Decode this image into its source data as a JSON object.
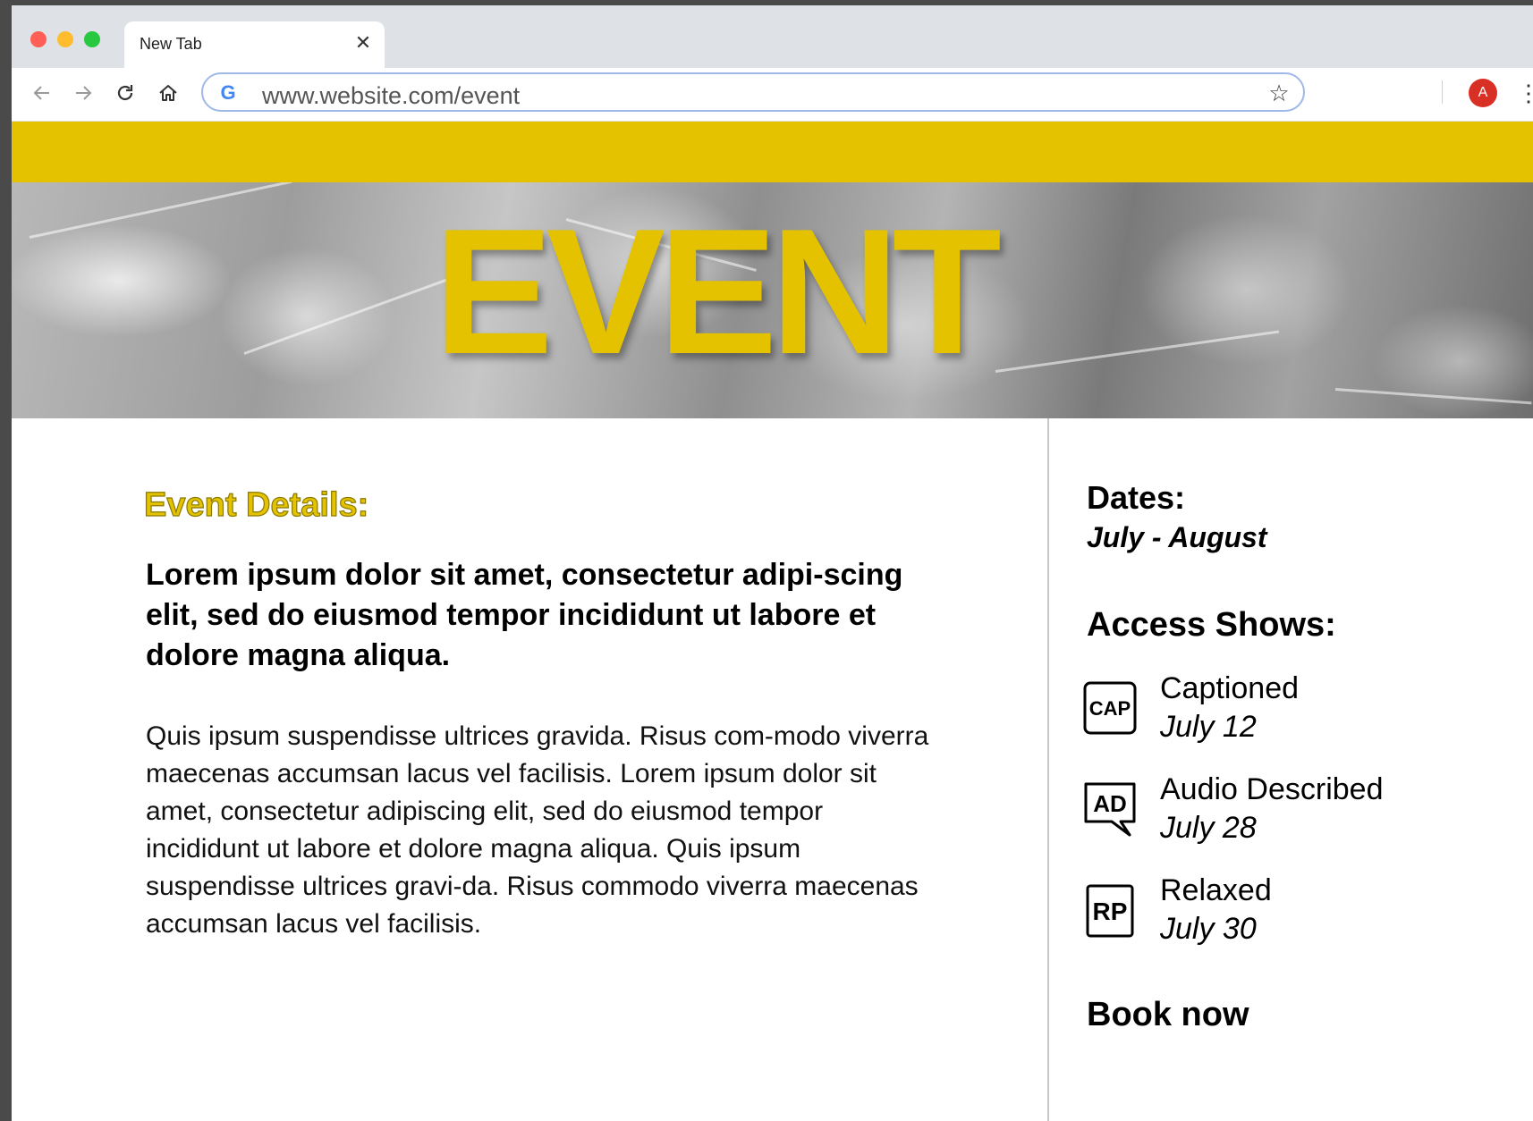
{
  "browser": {
    "tab": {
      "title": "New Tab",
      "close_glyph": "✕"
    },
    "address_bar": {
      "url": "www.website.com/event",
      "search_engine_glyph": "G"
    },
    "bookmark_glyph": "☆",
    "profile_initial": "A",
    "menu_glyph": "⋮",
    "icons": [
      "back-icon",
      "forward-icon",
      "reload-icon",
      "home-icon",
      "google-icon",
      "star-icon",
      "avatar",
      "more-menu-icon"
    ]
  },
  "hero": {
    "title": "EVENT"
  },
  "main": {
    "heading": "Event Details:",
    "lead": "Lorem ipsum dolor sit amet, consectetur adipi-scing elit, sed do eiusmod tempor incididunt ut labore et dolore magna aliqua.",
    "body": "Quis ipsum suspendisse ultrices gravida. Risus com-modo viverra maecenas accumsan lacus vel facilisis. Lorem ipsum dolor sit amet, consectetur adipiscing elit, sed do eiusmod tempor incididunt ut labore et dolore magna aliqua. Quis ipsum suspendisse ultrices gravi-da. Risus commodo viverra maecenas accumsan lacus vel facilisis."
  },
  "sidebar": {
    "dates_label": "Dates:",
    "dates_value": "July - August",
    "access_label": "Access Shows:",
    "shows": [
      {
        "name": "Captioned",
        "date": "July 12",
        "badge": "CAP",
        "icon": "captioned-icon"
      },
      {
        "name": "Audio Described",
        "date": "July 28",
        "badge": "AD",
        "icon": "audio-described-icon"
      },
      {
        "name": "Relaxed",
        "date": "July 30",
        "badge": "RP",
        "icon": "relaxed-performance-icon"
      }
    ],
    "book_now": "Book now"
  },
  "colors": {
    "accent_yellow": "#e4c200",
    "avatar_red": "#d93025",
    "tab_strip": "#dee1e6",
    "omnibox_border": "#9fb8e8"
  }
}
